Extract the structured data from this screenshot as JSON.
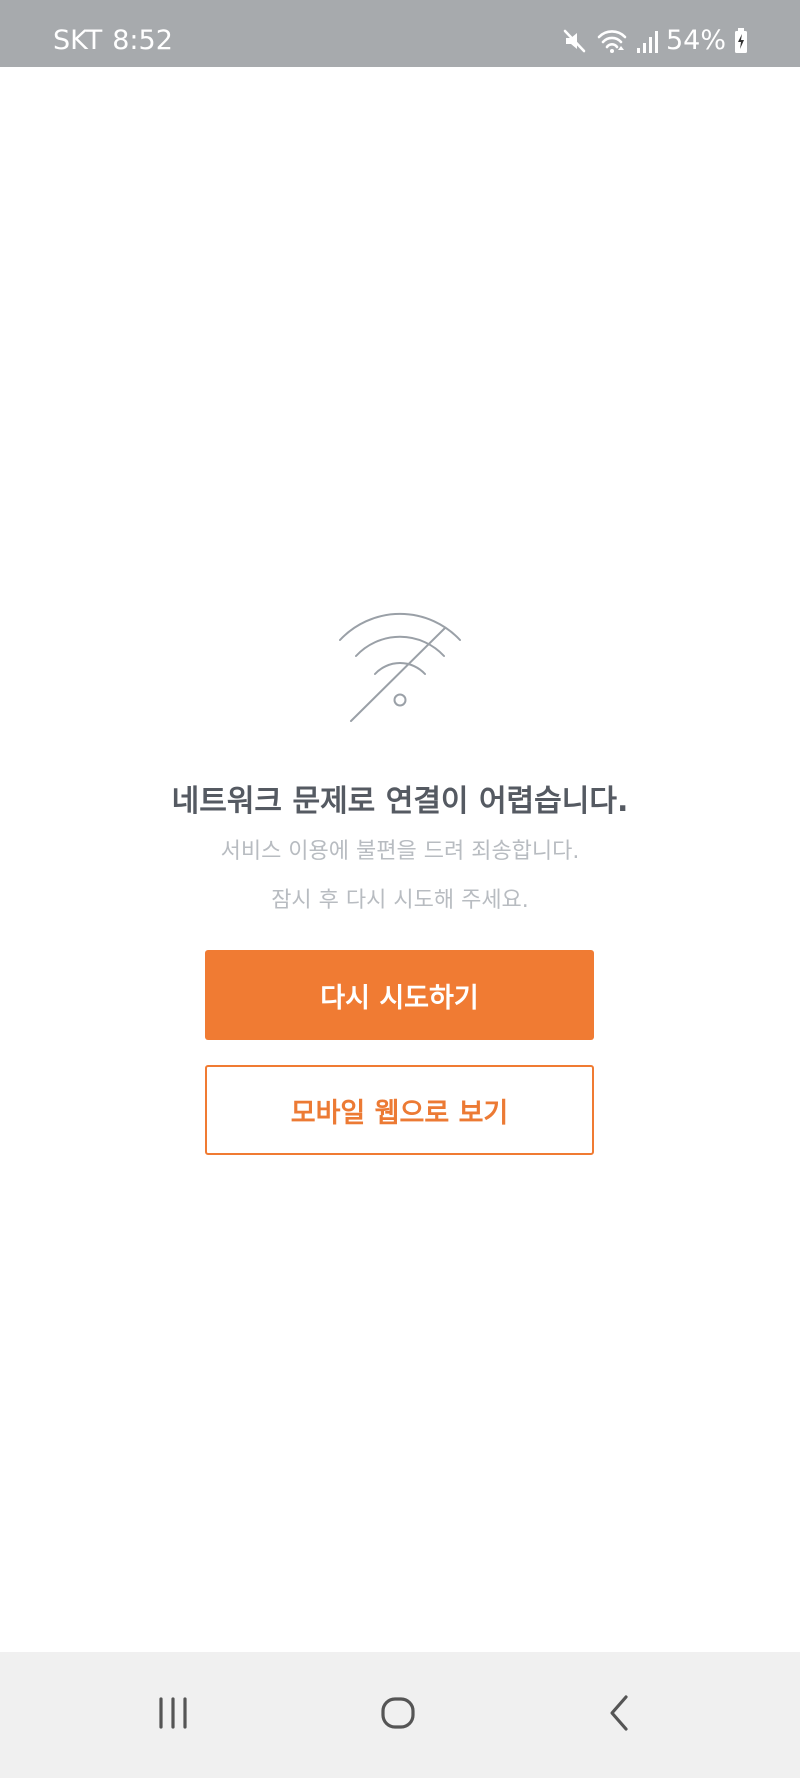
{
  "status_bar": {
    "carrier": "SKT",
    "time": "8:52",
    "battery_percent": "54%",
    "icons": [
      "mute-icon",
      "wifi-icon",
      "signal-icon",
      "battery-icon"
    ]
  },
  "error": {
    "icon": "wifi-off-icon",
    "title": "네트워크 문제로 연결이 어렵습니다.",
    "message_line1": "서비스 이용에 불편을 드려 죄송합니다.",
    "message_line2": "잠시 후 다시 시도해 주세요."
  },
  "buttons": {
    "retry_label": "다시 시도하기",
    "mobile_web_label": "모바일 웹으로 보기"
  },
  "nav_bar": {
    "items": [
      "recents-icon",
      "home-icon",
      "back-icon"
    ]
  },
  "colors": {
    "accent": "#f07b33",
    "title_text": "#555a62",
    "sub_text": "#b8bcc1",
    "status_bar_bg": "#a7aaad",
    "nav_bar_bg": "#f0f0f0"
  }
}
